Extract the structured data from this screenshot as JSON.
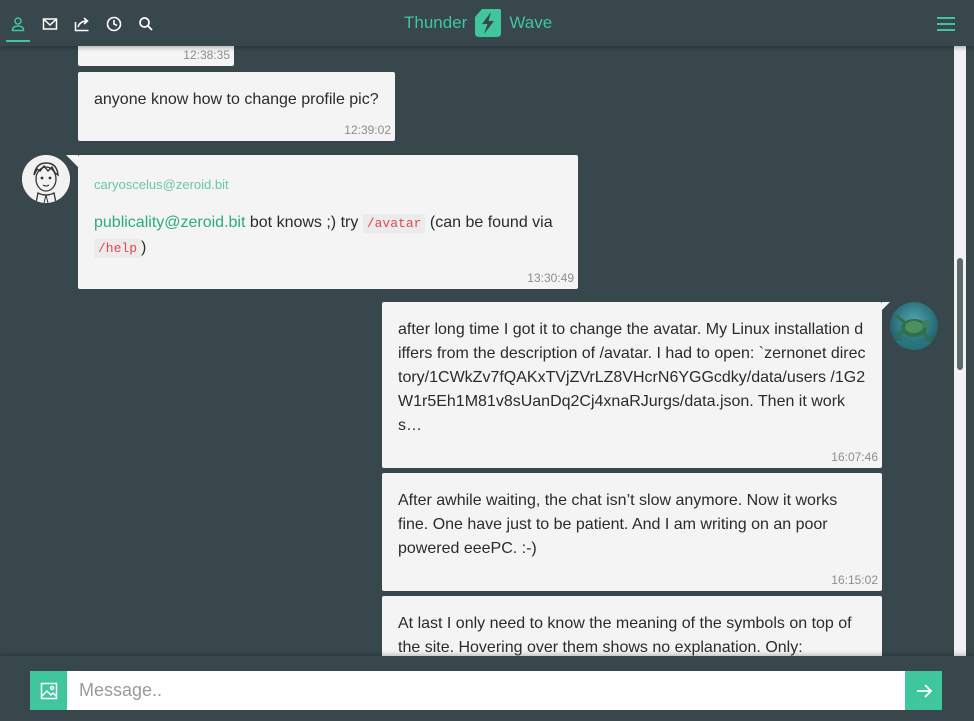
{
  "app": {
    "brand_left": "Thunder",
    "brand_right": "Wave",
    "accent": "#3fc69c"
  },
  "nav": {
    "items": [
      {
        "icon": "user-icon",
        "active": true
      },
      {
        "icon": "mail-icon",
        "active": false
      },
      {
        "icon": "share-icon",
        "active": false
      },
      {
        "icon": "clock-icon",
        "active": false
      },
      {
        "icon": "search-icon",
        "active": false
      }
    ],
    "menu_icon": "hamburger-menu-icon"
  },
  "messages": [
    {
      "time": "12:38:35"
    },
    {
      "text": "anyone know how to change profile pic?",
      "time": "12:39:02"
    },
    {
      "sender": "caryoscelus@zeroid.bit",
      "mention": "publicality@zeroid.bit",
      "text_a": "bot knows ;) try",
      "code_a": "/avatar",
      "text_b": "(can be found via",
      "code_b": "/help",
      "text_c": ")",
      "time": "13:30:49"
    },
    {
      "text": "after long time I got it to change the avatar. My Linux installation differs from the description of /avatar. I had to open: `zernonet directory/1CWkZv7fQAKxTVjZVrLZ8VHcrN6YGGcdky/data/users /1G2W1r5Eh1M81v8sUanDq2Cj4xnaRJurgs/data.json. Then it works…",
      "time": "16:07:46"
    },
    {
      "text": "After awhile waiting, the chat isn’t slow anymore. Now it works fine. One have just to be patient. And I am writing on an poor powered eeePC. :-)",
      "time": "16:15:02"
    },
    {
      "text": "At last I only need to know the meaning of the symbols on top of the site. Hovering over them shows no explanation. Only:"
    }
  ],
  "composer": {
    "placeholder": "Message..",
    "image_icon": "image-icon",
    "send_icon": "arrow-right-icon"
  }
}
